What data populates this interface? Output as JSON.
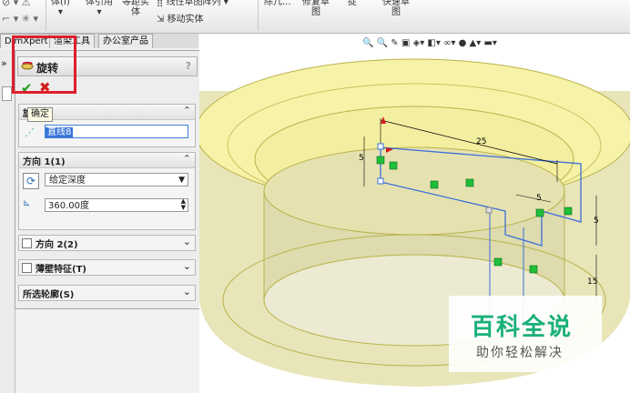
{
  "ribbon": {
    "items": [
      "体(I)",
      "体引用",
      "等距实\n体",
      "线性草图阵列",
      "移动实体",
      "除几...",
      "修复草\n图",
      "捉",
      "快速草\n图"
    ],
    "top_fragments": [
      "等距实",
      "修复草",
      "快速草"
    ]
  },
  "tabs": [
    "DimXpert",
    "渲染工具",
    "办公室产品"
  ],
  "panel": {
    "title": "旋转",
    "help": "?",
    "ok_icon": "checkmark-icon",
    "cancel_icon": "cross-icon",
    "tooltip": "确定",
    "axis_group": {
      "label": "旋(A)",
      "label_tail": "A)",
      "value": "直线8"
    },
    "direction1": {
      "label": "方向 1(1)",
      "type": "给定深度",
      "angle": "360.00度"
    },
    "direction2": {
      "label": "方向 2(2)"
    },
    "thin": {
      "label": "薄壁特征(T)"
    },
    "contours": {
      "label": "所选轮廓(S)"
    }
  },
  "viewport": {
    "dims": {
      "d25": "25",
      "d5a": "5",
      "d5b": "5",
      "d5c": "5",
      "d15": "15"
    }
  },
  "watermark": {
    "title": "百科全说",
    "subtitle": "助你轻松解决"
  },
  "colors": {
    "highlight_box": "#e01e2b",
    "yellow_body": "#f6f3a8",
    "constraint_green": "#1fbf3a",
    "sketch_blue": "#3b6fd8"
  }
}
